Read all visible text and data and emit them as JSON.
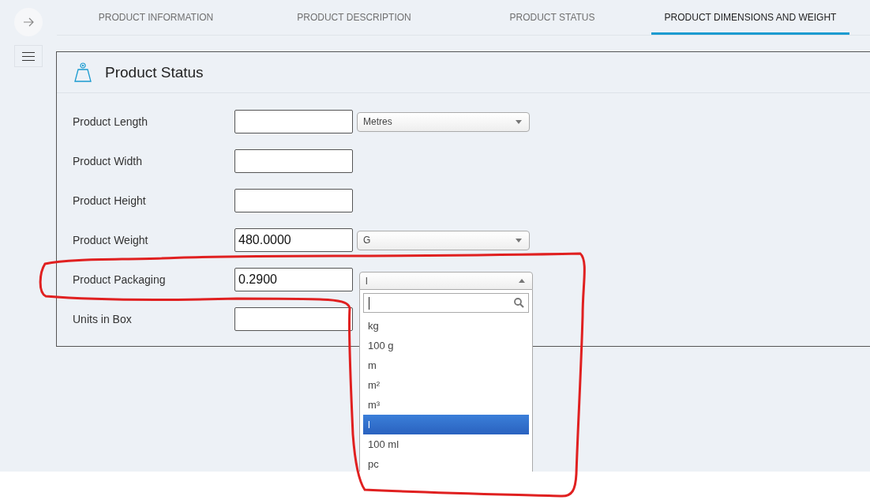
{
  "tabs": [
    {
      "label": "PRODUCT INFORMATION",
      "selected": false
    },
    {
      "label": "PRODUCT DESCRIPTION",
      "selected": false
    },
    {
      "label": "PRODUCT STATUS",
      "selected": false
    },
    {
      "label": "PRODUCT DIMENSIONS AND WEIGHT",
      "selected": true
    }
  ],
  "panel": {
    "title": "Product Status"
  },
  "fields": [
    {
      "label": "Product Length",
      "unit": {
        "value": "Metres",
        "expanded": false
      }
    },
    {
      "label": "Product Width"
    },
    {
      "label": "Product Height"
    },
    {
      "label": "Product Weight",
      "value": "480.0000",
      "unit": {
        "value": "G",
        "expanded": false
      }
    },
    {
      "label": "Product Packaging",
      "value": "0.2900",
      "unit": {
        "value": "l",
        "expanded": true,
        "options": [
          {
            "label": "kg",
            "selected": false
          },
          {
            "label": "100 g",
            "selected": false
          },
          {
            "label": "m",
            "selected": false
          },
          {
            "label": "m²",
            "selected": false
          },
          {
            "label": "m³",
            "selected": false
          },
          {
            "label": "l",
            "selected": true
          },
          {
            "label": "100 ml",
            "selected": false
          },
          {
            "label": "pc",
            "selected": false
          }
        ]
      }
    },
    {
      "label": "Units in Box"
    }
  ]
}
